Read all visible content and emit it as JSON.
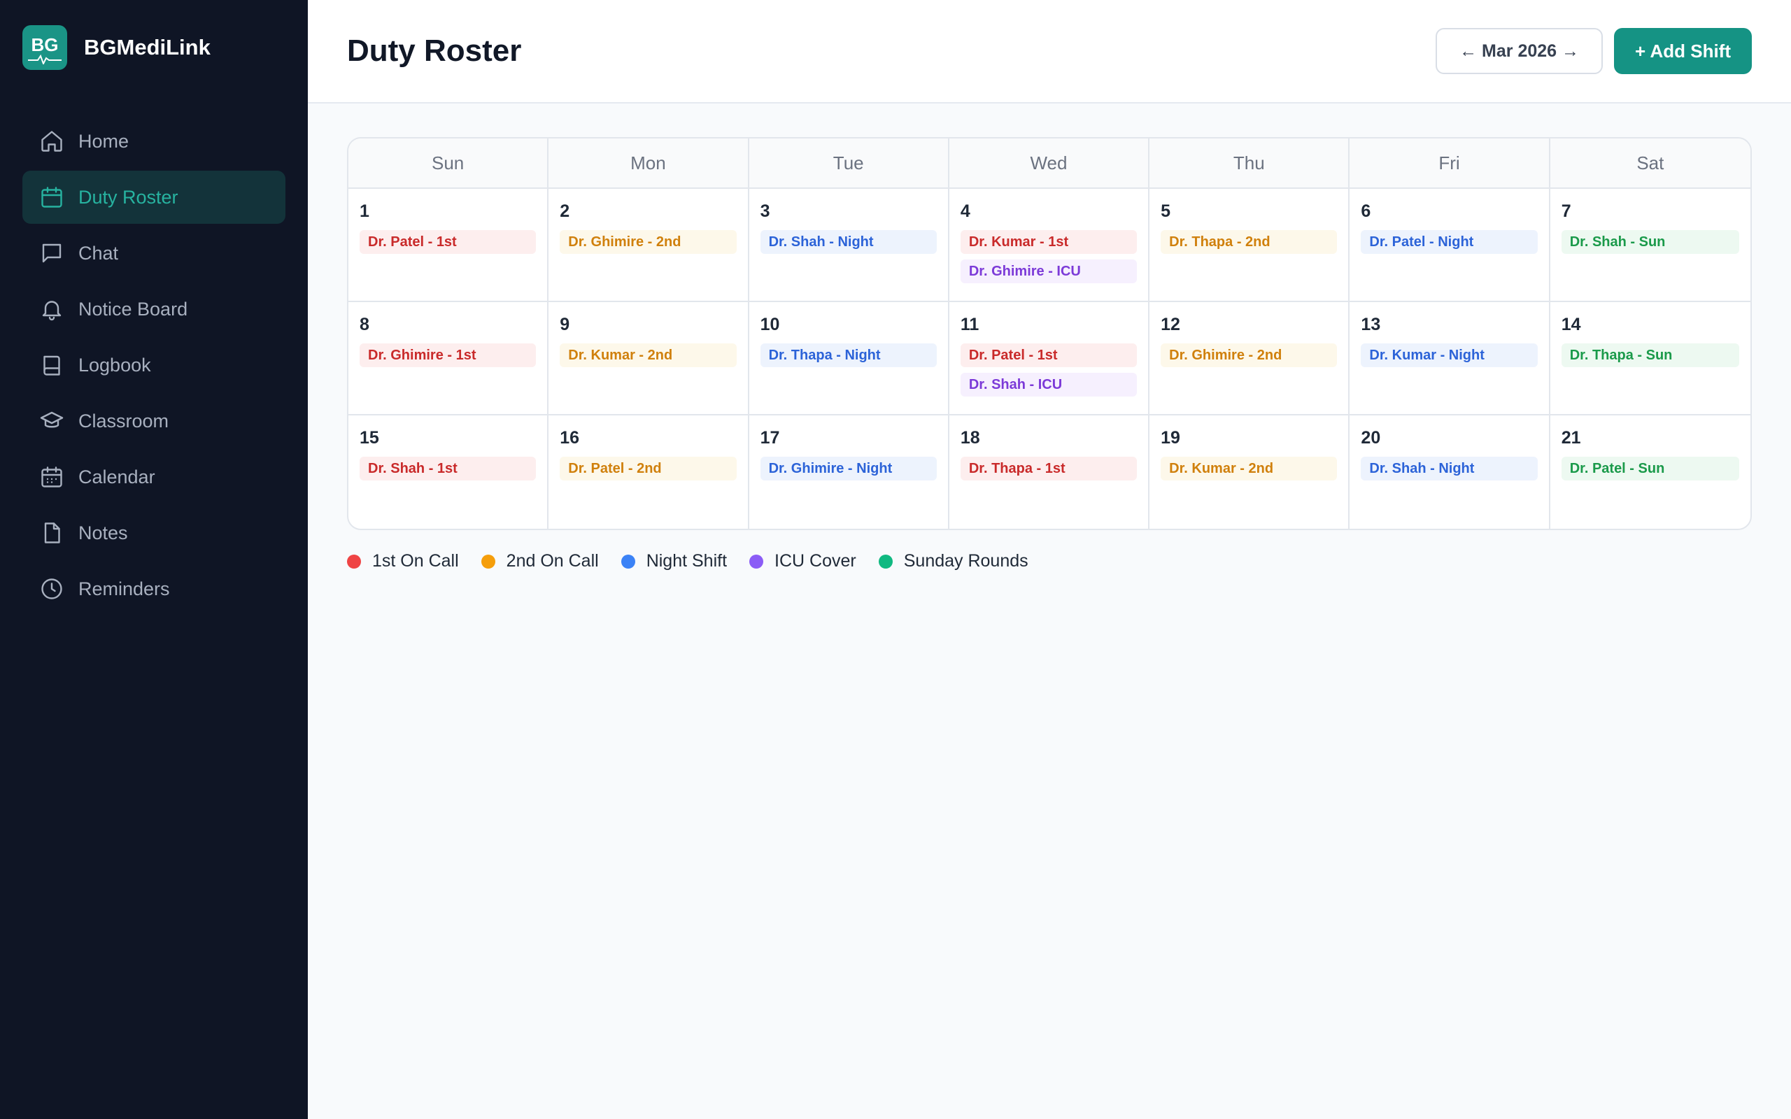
{
  "app": {
    "name": "BGMediLink",
    "logo_text": "BG"
  },
  "sidebar": {
    "items": [
      {
        "label": "Home",
        "icon": "home-icon",
        "active": false
      },
      {
        "label": "Duty Roster",
        "icon": "calendar-icon",
        "active": true
      },
      {
        "label": "Chat",
        "icon": "chat-icon",
        "active": false
      },
      {
        "label": "Notice Board",
        "icon": "bell-icon",
        "active": false
      },
      {
        "label": "Logbook",
        "icon": "book-icon",
        "active": false
      },
      {
        "label": "Classroom",
        "icon": "graduation-cap-icon",
        "active": false
      },
      {
        "label": "Calendar",
        "icon": "calendar-grid-icon",
        "active": false
      },
      {
        "label": "Notes",
        "icon": "file-icon",
        "active": false
      },
      {
        "label": "Reminders",
        "icon": "clock-icon",
        "active": false
      }
    ]
  },
  "header": {
    "title": "Duty Roster",
    "month_label": "← Mar 2026 →",
    "add_label": "+ Add Shift"
  },
  "calendar": {
    "weekdays": [
      "Sun",
      "Mon",
      "Tue",
      "Wed",
      "Thu",
      "Fri",
      "Sat"
    ],
    "days": [
      {
        "num": "1",
        "shifts": [
          {
            "label": "Dr. Patel - 1st",
            "type": "first"
          }
        ]
      },
      {
        "num": "2",
        "shifts": [
          {
            "label": "Dr. Ghimire - 2nd",
            "type": "second"
          }
        ]
      },
      {
        "num": "3",
        "shifts": [
          {
            "label": "Dr. Shah - Night",
            "type": "night"
          }
        ]
      },
      {
        "num": "4",
        "shifts": [
          {
            "label": "Dr. Kumar - 1st",
            "type": "first"
          },
          {
            "label": "Dr. Ghimire - ICU",
            "type": "icu"
          }
        ]
      },
      {
        "num": "5",
        "shifts": [
          {
            "label": "Dr. Thapa - 2nd",
            "type": "second"
          }
        ]
      },
      {
        "num": "6",
        "shifts": [
          {
            "label": "Dr. Patel - Night",
            "type": "night"
          }
        ]
      },
      {
        "num": "7",
        "shifts": [
          {
            "label": "Dr. Shah - Sun",
            "type": "sun"
          }
        ]
      },
      {
        "num": "8",
        "shifts": [
          {
            "label": "Dr. Ghimire - 1st",
            "type": "first"
          }
        ]
      },
      {
        "num": "9",
        "shifts": [
          {
            "label": "Dr. Kumar - 2nd",
            "type": "second"
          }
        ]
      },
      {
        "num": "10",
        "shifts": [
          {
            "label": "Dr. Thapa - Night",
            "type": "night"
          }
        ]
      },
      {
        "num": "11",
        "shifts": [
          {
            "label": "Dr. Patel - 1st",
            "type": "first"
          },
          {
            "label": "Dr. Shah - ICU",
            "type": "icu"
          }
        ]
      },
      {
        "num": "12",
        "shifts": [
          {
            "label": "Dr. Ghimire - 2nd",
            "type": "second"
          }
        ]
      },
      {
        "num": "13",
        "shifts": [
          {
            "label": "Dr. Kumar - Night",
            "type": "night"
          }
        ]
      },
      {
        "num": "14",
        "shifts": [
          {
            "label": "Dr. Thapa - Sun",
            "type": "sun"
          }
        ]
      },
      {
        "num": "15",
        "shifts": [
          {
            "label": "Dr. Shah - 1st",
            "type": "first"
          }
        ]
      },
      {
        "num": "16",
        "shifts": [
          {
            "label": "Dr. Patel - 2nd",
            "type": "second"
          }
        ]
      },
      {
        "num": "17",
        "shifts": [
          {
            "label": "Dr. Ghimire - Night",
            "type": "night"
          }
        ]
      },
      {
        "num": "18",
        "shifts": [
          {
            "label": "Dr. Thapa - 1st",
            "type": "first"
          }
        ]
      },
      {
        "num": "19",
        "shifts": [
          {
            "label": "Dr. Kumar - 2nd",
            "type": "second"
          }
        ]
      },
      {
        "num": "20",
        "shifts": [
          {
            "label": "Dr. Shah - Night",
            "type": "night"
          }
        ]
      },
      {
        "num": "21",
        "shifts": [
          {
            "label": "Dr. Patel - Sun",
            "type": "sun"
          }
        ]
      }
    ]
  },
  "legend": [
    {
      "label": "1st On Call",
      "color": "#ef4444"
    },
    {
      "label": "2nd On Call",
      "color": "#f59e0b"
    },
    {
      "label": "Night Shift",
      "color": "#3b82f6"
    },
    {
      "label": "ICU Cover",
      "color": "#8b5cf6"
    },
    {
      "label": "Sunday Rounds",
      "color": "#10b981"
    }
  ],
  "colors": {
    "accent": "#159384",
    "sidebar_bg": "#0f1525"
  }
}
